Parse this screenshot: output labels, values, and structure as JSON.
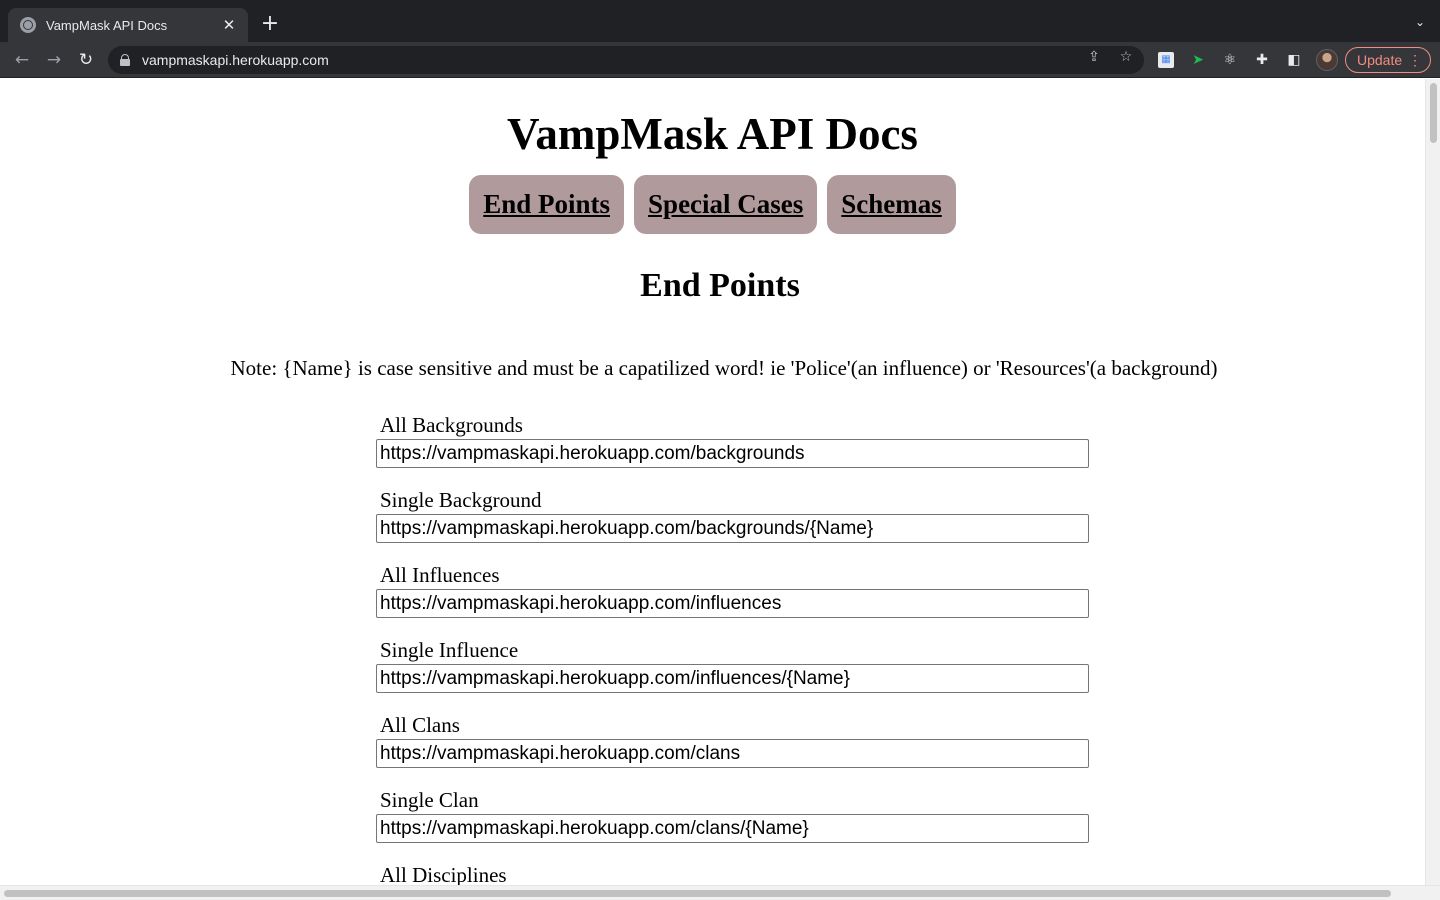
{
  "browser": {
    "tab_title": "VampMask API Docs",
    "url": "vampmaskapi.herokuapp.com",
    "update_label": "Update"
  },
  "page": {
    "title": "VampMask API Docs",
    "nav": [
      "End Points",
      "Special Cases",
      "Schemas"
    ],
    "section_title": "End Points",
    "note": "Note: {Name} is case sensitive and must be a capatilized word! ie 'Police'(an influence) or 'Resources'(a background)",
    "endpoints": [
      {
        "label": "All Backgrounds",
        "url": "https://vampmaskapi.herokuapp.com/backgrounds"
      },
      {
        "label": "Single Background",
        "url": "https://vampmaskapi.herokuapp.com/backgrounds/{Name}"
      },
      {
        "label": "All Influences",
        "url": "https://vampmaskapi.herokuapp.com/influences"
      },
      {
        "label": "Single Influence",
        "url": "https://vampmaskapi.herokuapp.com/influences/{Name}"
      },
      {
        "label": "All Clans",
        "url": "https://vampmaskapi.herokuapp.com/clans"
      },
      {
        "label": "Single Clan",
        "url": "https://vampmaskapi.herokuapp.com/clans/{Name}"
      },
      {
        "label": "All Disciplines",
        "url": ""
      }
    ]
  },
  "colors": {
    "nav_button_bg": "#b09a9c",
    "chrome_dark": "#202124",
    "chrome_toolbar": "#35363a",
    "update_accent": "#f28b82"
  }
}
